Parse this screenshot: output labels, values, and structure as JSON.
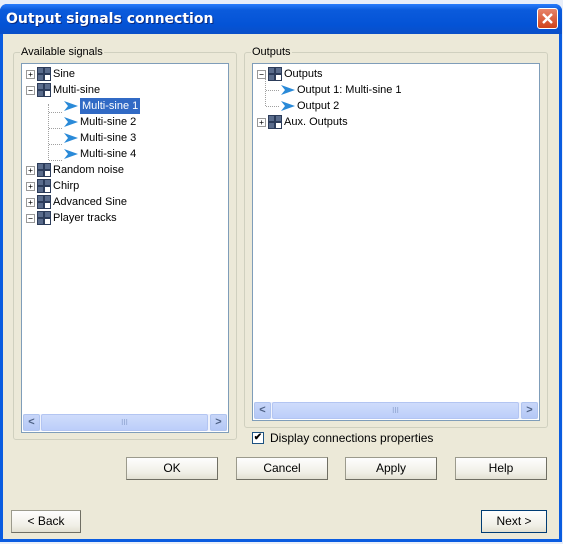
{
  "window": {
    "title": "Output signals connection",
    "close_label": "Close"
  },
  "available": {
    "group_label": "Available signals",
    "items": [
      {
        "label": "Sine",
        "expander": "+"
      },
      {
        "label": "Multi-sine",
        "expander": "−"
      },
      {
        "label": "Multi-sine 1",
        "selected": true
      },
      {
        "label": "Multi-sine 2"
      },
      {
        "label": "Multi-sine 3"
      },
      {
        "label": "Multi-sine 4"
      },
      {
        "label": "Random noise",
        "expander": "+"
      },
      {
        "label": "Chirp",
        "expander": "+"
      },
      {
        "label": "Advanced Sine",
        "expander": "+"
      },
      {
        "label": "Player tracks",
        "expander": "−"
      }
    ]
  },
  "outputs": {
    "group_label": "Outputs",
    "items": [
      {
        "label": "Outputs",
        "expander": "−"
      },
      {
        "label": "Output 1: Multi-sine 1"
      },
      {
        "label": "Output 2"
      },
      {
        "label": "Aux. Outputs",
        "expander": "+"
      }
    ]
  },
  "scroll": {
    "left": "<",
    "right": ">",
    "grip": "III"
  },
  "checkbox": {
    "label": "Display connections properties",
    "checked": "✔"
  },
  "buttons": {
    "ok": "OK",
    "cancel": "Cancel",
    "apply": "Apply",
    "help": "Help",
    "back": "< Back",
    "next": "Next >"
  },
  "colors": {
    "selection": "#316ac5",
    "titlebar": "#0453d6"
  }
}
